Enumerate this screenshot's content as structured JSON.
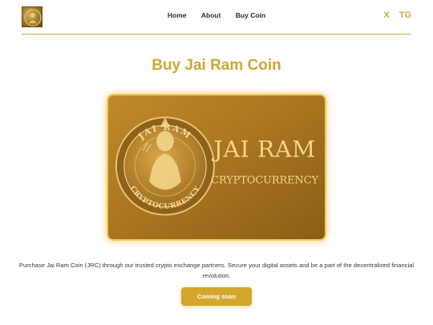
{
  "header": {
    "logo_icon": "coin-logo-icon",
    "nav": [
      "Home",
      "About",
      "Buy Coin"
    ],
    "social": [
      "X",
      "TG"
    ]
  },
  "main": {
    "title": "Buy Jai Ram Coin",
    "banner": {
      "coin_top_text": "JAI RAM",
      "coin_bottom_text": "CRYPTOCURRENCY",
      "headline": "JAI RAM",
      "subline": "CRYPTOCURRENCY"
    },
    "description": "Purchase Jai Ram Coin (JRC) through our trusted crypto exchange partners. Secure your digital assets and be a part of the decentralized financial revolution.",
    "cta_label": "Coming soon"
  },
  "colors": {
    "accent": "#d4a72c",
    "divider": "#cfa93a",
    "text": "#2b2b2b"
  }
}
